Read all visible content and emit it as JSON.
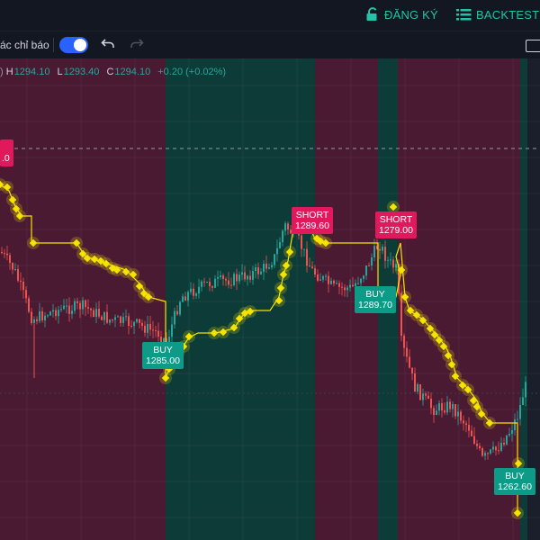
{
  "header": {
    "register_label": "ĐĂNG KÝ",
    "backtest_label": "BACKTEST"
  },
  "toolbar": {
    "indicators_label": "ác chỉ báo"
  },
  "legend": {
    "prefix": ")",
    "high_label": "H",
    "high": "1294.10",
    "low_label": "L",
    "low": "1293.40",
    "close_label": "C",
    "close": "1294.10",
    "change": "+0.20 (+0.02%)"
  },
  "colors": {
    "accent": "#22c3a6",
    "toggle": "#2962ff",
    "short_zone": "#4a1a33",
    "long_zone": "#0d3b37",
    "signal_line": "#f5e300",
    "short_label": "#e0195c",
    "buy_label": "#0d9a87"
  },
  "signals": [
    {
      "type": "SHORT",
      "label": "SHORT",
      "price": "1289.60"
    },
    {
      "type": "SHORT",
      "label": "SHORT",
      "price": "1279.00"
    },
    {
      "type": "BUY",
      "label": "BUY",
      "price": "1289.70"
    },
    {
      "type": "BUY",
      "label": "BUY",
      "price": "1285.00"
    },
    {
      "type": "BUY",
      "label": "BUY",
      "price": "1262.60"
    },
    {
      "type": "SHORT",
      "label": "",
      "price": "0"
    }
  ]
}
